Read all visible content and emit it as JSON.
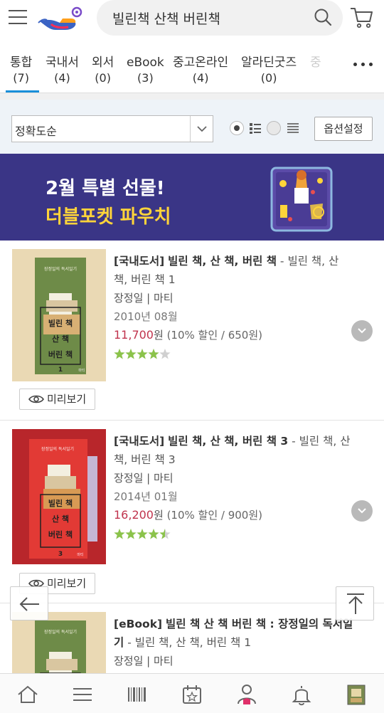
{
  "header": {
    "search_query": "빌린책 산책 버린책"
  },
  "tabs": [
    {
      "label": "통합",
      "count": "(7)",
      "active": true
    },
    {
      "label": "국내서",
      "count": "(4)"
    },
    {
      "label": "외서",
      "count": "(0)"
    },
    {
      "label": "eBook",
      "count": "(3)"
    },
    {
      "label": "중고온라인",
      "count": "(4)"
    },
    {
      "label": "알라딘굿즈",
      "count": "(0)"
    },
    {
      "label": "중",
      "count": ""
    }
  ],
  "sortbar": {
    "sort_value": "정확도순",
    "option_button": "옵션설정"
  },
  "banner": {
    "line1": "2월 특별 선물!",
    "line2": "더블포켓 파우치"
  },
  "cover_text": {
    "series": "장정일의 독서일기",
    "word1": "빌린 책",
    "word2": "산 책",
    "word3": "버린 책",
    "publisher": "마티"
  },
  "results": [
    {
      "category": "[국내도서]",
      "title": "빌린 책, 산 책, 버린 책",
      "subtitle": " - 빌린 책, 산 책, 버린 책 1",
      "author_publisher": "장정일 | 마티",
      "date": "2010년 08월",
      "price": "11,700",
      "price_unit": "원",
      "discount": " (10% 할인 / 650원)",
      "rating": 4,
      "volume": "1",
      "preview": "미리보기"
    },
    {
      "category": "[국내도서]",
      "title": "빌린 책, 산 책, 버린 책 3",
      "subtitle": " - 빌린 책, 산 책, 버린 책 3",
      "author_publisher": "장정일 | 마티",
      "date": "2014년 01월",
      "price": "16,200",
      "price_unit": "원",
      "discount": " (10% 할인 / 900원)",
      "rating": 4.5,
      "volume": "3",
      "preview": "미리보기"
    },
    {
      "category": "[eBook]",
      "title": "빌린 책 산 책 버린 책 : 장정일의 독서일기",
      "subtitle": " - 빌린 책, 산 책, 버린 책 1",
      "author_publisher": "장정일 | 마티"
    }
  ],
  "colors": {
    "accent_blue": "#1a8fd9",
    "banner_bg": "#3a3586",
    "banner_yellow": "#ffd43a",
    "price_red": "#c0334d",
    "star_green": "#8bc34a"
  },
  "icons": {
    "menu": "hamburger-icon",
    "search": "search-icon",
    "cart": "cart-icon",
    "more": "more-dots-icon",
    "back": "arrow-left-icon",
    "top": "scroll-top-icon",
    "nav": [
      "home-icon",
      "menu-list-icon",
      "barcode-icon",
      "calendar-icon",
      "user-icon",
      "bell-icon",
      "book-icon"
    ]
  }
}
